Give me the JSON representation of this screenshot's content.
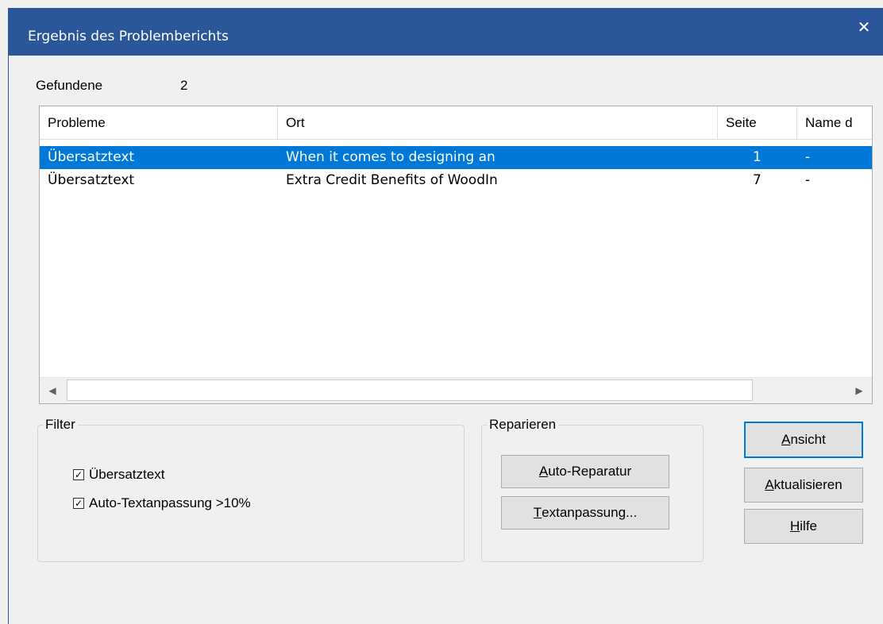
{
  "window": {
    "title": "Ergebnis des Problemberichts",
    "close_glyph": "✕"
  },
  "found": {
    "label": "Gefundene",
    "value": "2"
  },
  "list": {
    "columns": [
      "Probleme",
      "Ort",
      "Seite",
      "Name d"
    ],
    "rows": [
      {
        "problem": "Übersatztext",
        "location": "When it comes to designing an",
        "page": "1",
        "name": "-",
        "selected": true
      },
      {
        "problem": "Übersatztext",
        "location": "Extra Credit Benefits of WoodIn",
        "page": "7",
        "name": "-",
        "selected": false
      }
    ],
    "scroll_left_icon": "◀",
    "scroll_right_icon": "▶"
  },
  "filter": {
    "title": "Filter",
    "options": [
      {
        "label": "Übersatztext",
        "checked": true
      },
      {
        "label": "Auto-Textanpassung >10%",
        "checked": true
      }
    ]
  },
  "repair": {
    "title": "Reparieren",
    "auto_repair": {
      "mnemonic": "A",
      "rest": "uto-Reparatur"
    },
    "text_fit": {
      "mnemonic": "T",
      "rest": "extanpassung..."
    }
  },
  "buttons": {
    "view": {
      "mnemonic": "A",
      "rest": "nsicht"
    },
    "refresh": {
      "mnemonic": "A",
      "rest": "ktualisieren"
    },
    "help": {
      "mnemonic": "H",
      "rest": "ilfe"
    }
  },
  "colors": {
    "titlebar": "#2b579a",
    "selection": "#0078d7"
  }
}
